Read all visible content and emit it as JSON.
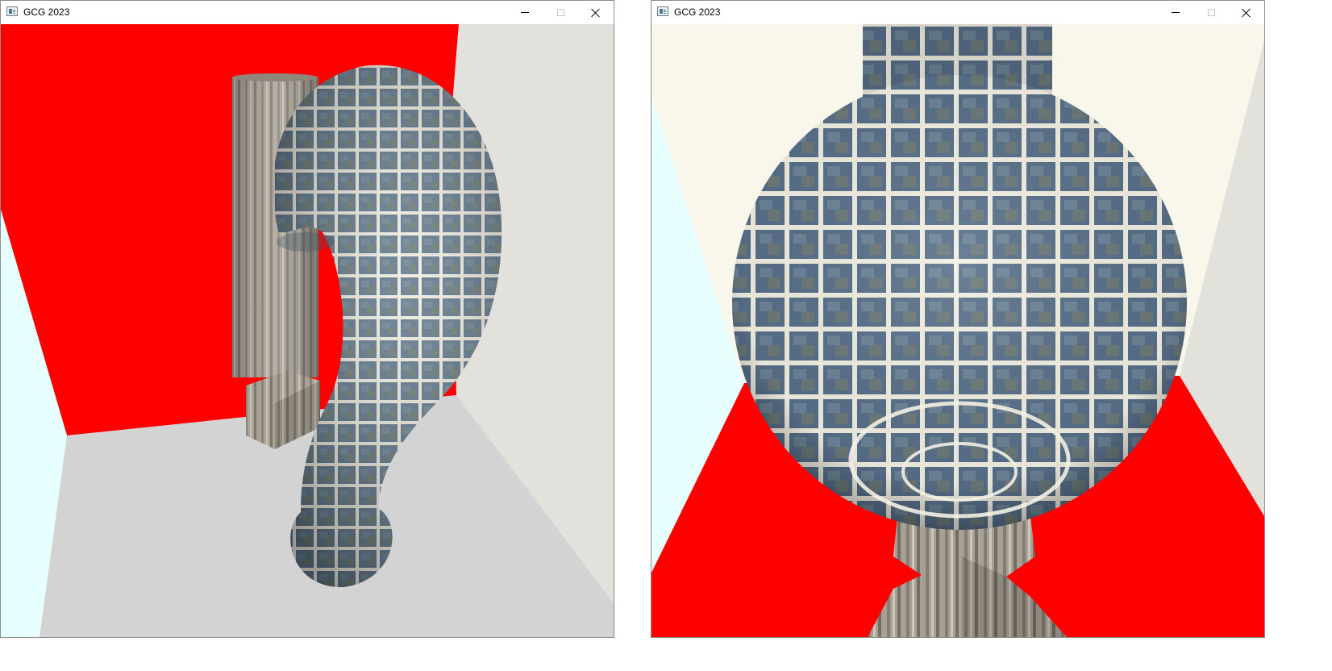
{
  "windows": [
    {
      "title": "GCG 2023",
      "scene": "Room with red back wall, grey floor and a tiled torus-shaped pipe next to a wooden cylinder"
    },
    {
      "title": "GCG 2023",
      "scene": "Close-up view of a tiled sphere above a wooden pillar with a red floor"
    }
  ],
  "caption_buttons": {
    "minimize_icon": "minimize-icon",
    "maximize_icon": "maximize-icon",
    "close_icon": "close-icon"
  },
  "colors": {
    "red_wall": "#ff0000",
    "floor_grey": "#d3d3d3",
    "side_wall_cyan": "#e8ffff",
    "side_wall_grey": "#e3e1db",
    "back_wall_cream": "#f9f7ec",
    "tile_blue": "#5b7388",
    "tile_grout": "#f2efe2",
    "wood": "#a29a8e"
  }
}
